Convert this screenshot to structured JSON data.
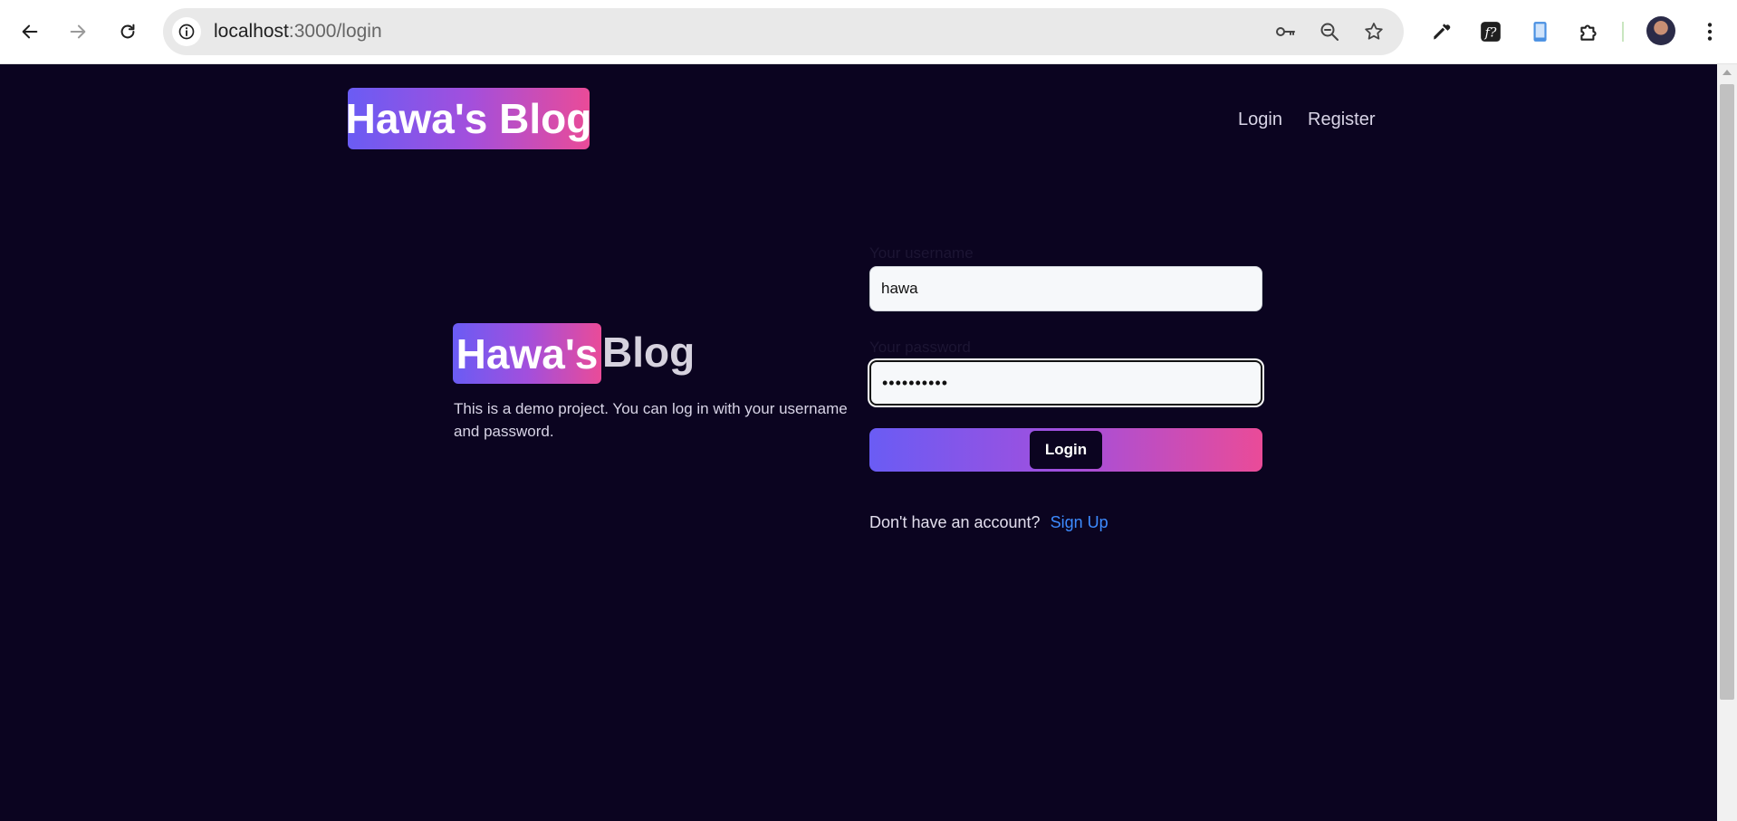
{
  "browser": {
    "url_host": "localhost",
    "url_path": ":3000/login"
  },
  "header": {
    "logo_text": "Hawa's Blog",
    "nav": [
      "Login",
      "Register"
    ]
  },
  "hero": {
    "badge": "Hawa's",
    "title_rest": "Blog",
    "description": "This is a demo project. You can log in with your username and password."
  },
  "form": {
    "username_label": "Your username",
    "username_value": "hawa",
    "password_label": "Your password",
    "password_mask": "••••••••••",
    "login_button": "Login",
    "signup_prompt": "Don't have an account?",
    "signup_link": "Sign Up"
  },
  "colors": {
    "page_bg": "#0b0420",
    "gradient_start": "#6a5cf4",
    "gradient_end": "#ea4b98",
    "link": "#3d8bff"
  }
}
